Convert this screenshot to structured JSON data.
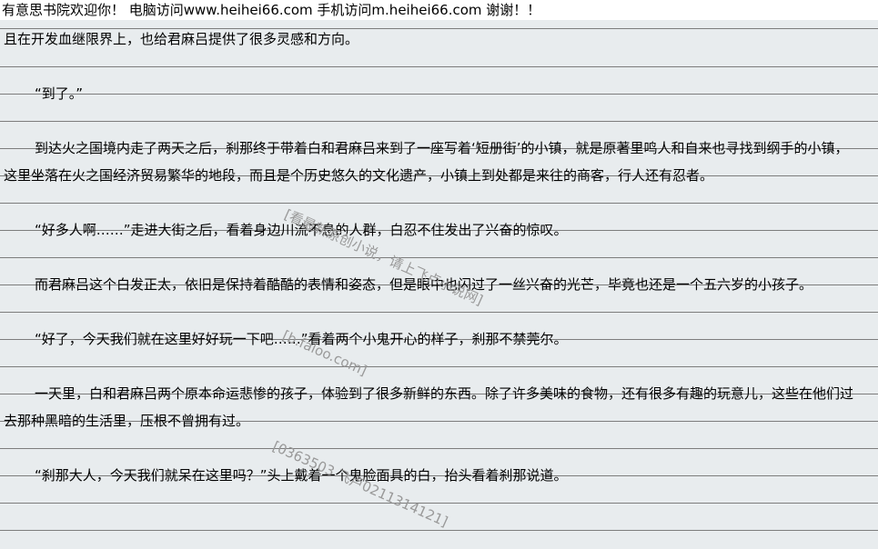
{
  "banner": {
    "text": "有意思书院欢迎你！ 电脑访问www.heihei66.com   手机访问m.heihei66.com  谢谢！！"
  },
  "paragraphs": [
    {
      "text": "且在开发血继限界上，也给君麻吕提供了很多灵感和方向。",
      "indent": false
    },
    {
      "text": "“到了。”",
      "indent": true
    },
    {
      "text": "到达火之国境内走了两天之后，刹那终于带着白和君麻吕来到了一座写着‘短册街’的小镇，就是原著里鸣人和自来也寻找到纲手的小镇，这里坐落在火之国经济贸易繁华的地段，而且是个历史悠久的文化遗产，小镇上到处都是来往的商客，行人还有忍者。",
      "indent": true
    },
    {
      "text": "“好多人啊……”走进大街之后，看着身边川流不息的人群，白忍不住发出了兴奋的惊叹。",
      "indent": true
    },
    {
      "text": "而君麻吕这个白发正太，依旧是保持着酷酷的表情和姿态，但是眼中也闪过了一丝兴奋的光芒，毕竟也还是一个五六岁的小孩子。",
      "indent": true
    },
    {
      "text": "“好了，今天我们就在这里好好玩一下吧……”看着两个小鬼开心的样子，刹那不禁莞尔。",
      "indent": true
    },
    {
      "text": "一天里，白和君麻吕两个原本命运悲惨的孩子，体验到了很多新鲜的东西。除了许多美味的食物，还有很多有趣的玩意儿，这些在他们过去那种黑暗的生活里，压根不曾拥有过。",
      "indent": true
    },
    {
      "text": "“刹那大人，今天我们就呆在这里吗？”头上戴着一个鬼脸面具的白，抬头看着刹那说道。",
      "indent": true
    }
  ],
  "watermarks": [
    {
      "text": "[看最新原创小说，请上飞卢小说网]"
    },
    {
      "text": "[b.faloo.com]"
    },
    {
      "text": "[0363503 飞卢0211314121]"
    }
  ]
}
